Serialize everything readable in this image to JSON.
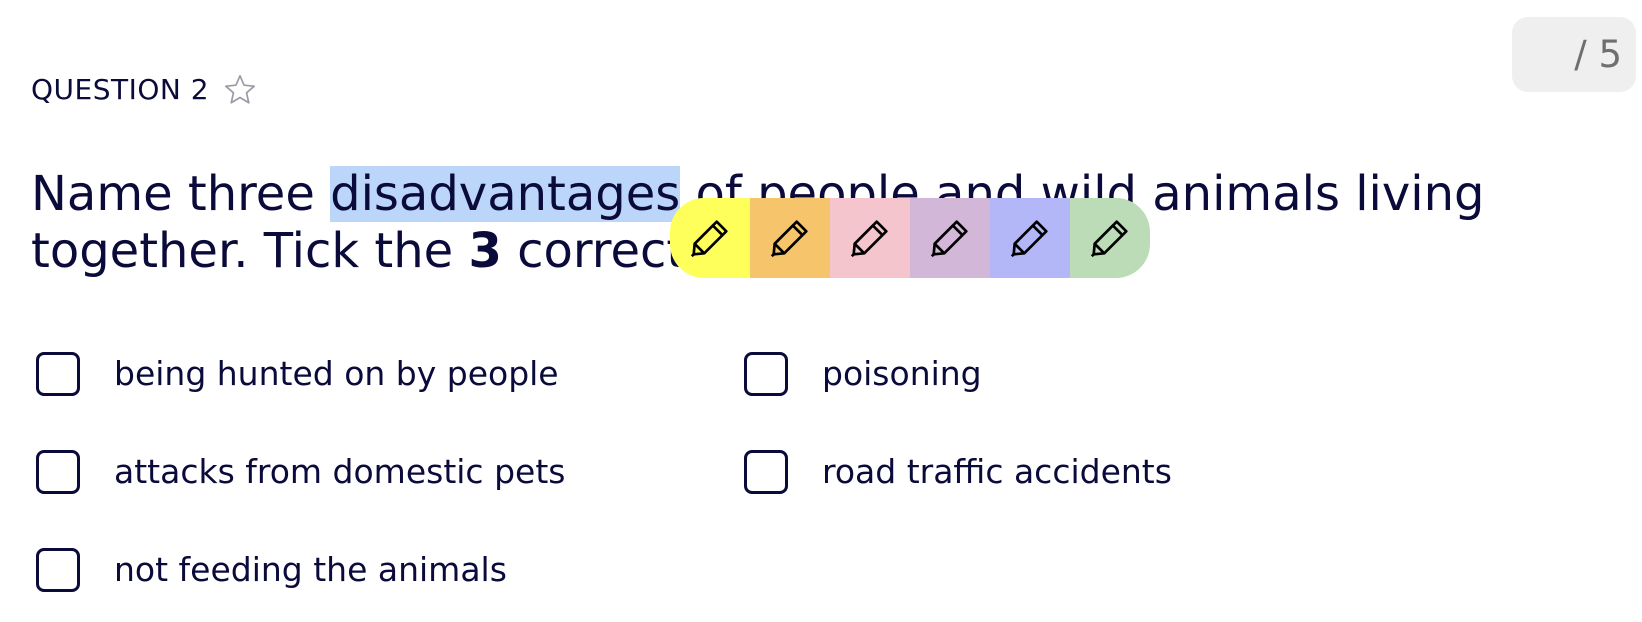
{
  "score": {
    "text": "/ 5"
  },
  "question": {
    "label": "QUESTION 2",
    "text_before": "Name three ",
    "highlighted_word": "disadvantages",
    "text_middle": " of people and wild animals living together. Tick the ",
    "bold_number": "3",
    "text_after": " correct phrases."
  },
  "highlight_toolbar": {
    "swatches": [
      {
        "name": "yellow",
        "color": "#ffff5c",
        "icon": "pencil-icon"
      },
      {
        "name": "orange",
        "color": "#f5c46b",
        "icon": "pencil-icon"
      },
      {
        "name": "pink",
        "color": "#f5c5ce",
        "icon": "pencil-icon"
      },
      {
        "name": "purple",
        "color": "#d3b7d8",
        "icon": "pencil-icon"
      },
      {
        "name": "blue",
        "color": "#b3b6f7",
        "icon": "pencil-icon"
      },
      {
        "name": "green",
        "color": "#bcdcb8",
        "icon": "pencil-icon"
      }
    ]
  },
  "options": [
    {
      "label": "being hunted on by people",
      "checked": false
    },
    {
      "label": "poisoning",
      "checked": false
    },
    {
      "label": "attacks from domestic pets",
      "checked": false
    },
    {
      "label": "road traffic accidents",
      "checked": false
    },
    {
      "label": "not feeding the animals",
      "checked": false
    }
  ],
  "colors": {
    "text": "#0b0b3b",
    "selection": "#bcd6fa",
    "score_bg": "#efefef"
  }
}
